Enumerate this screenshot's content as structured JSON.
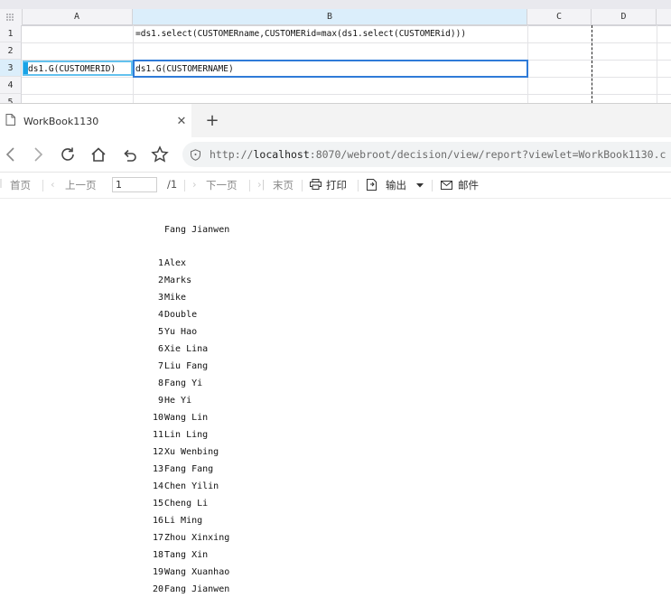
{
  "designer": {
    "columns": [
      "A",
      "B",
      "C",
      "D"
    ],
    "rows": [
      "1",
      "2",
      "3",
      "4",
      "5"
    ],
    "corner_icon": "grid-dots-icon",
    "cells": {
      "B1": "=ds1.select(CUSTOMERname,CUSTOMERid=max(ds1.select(CUSTOMERid)))",
      "A3": "ds1.G(CUSTOMERID)",
      "B3": "ds1.G(CUSTOMERNAME)"
    },
    "selected_column": "B",
    "selected_row": "3",
    "accent": "#2f7bd8"
  },
  "browser": {
    "tab_title": "WorkBook1130",
    "tab_icon": "page-icon",
    "close_icon": "close-icon",
    "new_tab_icon": "plus-icon",
    "url_prefix": "http://",
    "url_host": "localhost",
    "url_rest": ":8070/webroot/decision/view/report?viewlet=WorkBook1130.c",
    "nav_icons": [
      "back-icon",
      "forward-icon",
      "reload-icon",
      "home-icon",
      "undo-icon",
      "star-icon",
      "info-icon"
    ]
  },
  "report_toolbar": {
    "first_page": "首页",
    "prev_page": "上一页",
    "page_value": "1",
    "page_total": "/1",
    "next_page": "下一页",
    "last_page": "末页",
    "print": "打印",
    "export": "输出",
    "email": "邮件"
  },
  "report": {
    "title": "Fang Jianwen",
    "rows": [
      {
        "id": "1",
        "name": "Alex"
      },
      {
        "id": "2",
        "name": "Marks"
      },
      {
        "id": "3",
        "name": "Mike"
      },
      {
        "id": "4",
        "name": "Double"
      },
      {
        "id": "5",
        "name": "Yu Hao"
      },
      {
        "id": "6",
        "name": "Xie Lina"
      },
      {
        "id": "7",
        "name": "Liu Fang"
      },
      {
        "id": "8",
        "name": "Fang Yi"
      },
      {
        "id": "9",
        "name": "He Yi"
      },
      {
        "id": "10",
        "name": "Wang Lin"
      },
      {
        "id": "11",
        "name": "Lin Ling"
      },
      {
        "id": "12",
        "name": "Xu Wenbing"
      },
      {
        "id": "13",
        "name": "Fang Fang"
      },
      {
        "id": "14",
        "name": "Chen Yilin"
      },
      {
        "id": "15",
        "name": "Cheng Li"
      },
      {
        "id": "16",
        "name": "Li Ming"
      },
      {
        "id": "17",
        "name": "Zhou Xinxing"
      },
      {
        "id": "18",
        "name": "Tang Xin"
      },
      {
        "id": "19",
        "name": "Wang Xuanhao"
      },
      {
        "id": "20",
        "name": "Fang Jianwen"
      }
    ]
  }
}
